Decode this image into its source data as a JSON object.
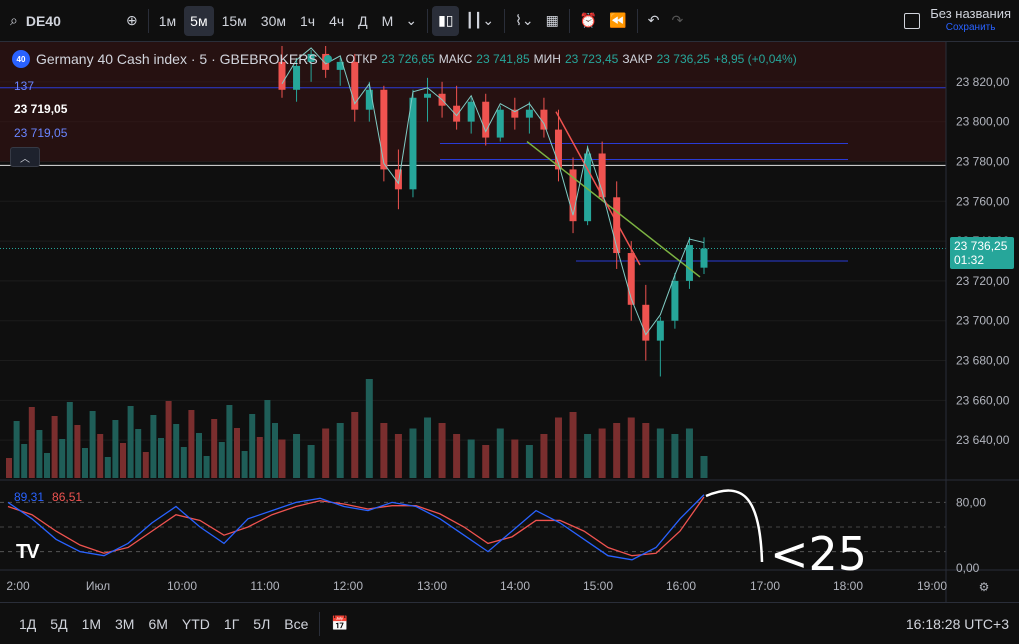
{
  "toolbar": {
    "symbol": "DE40",
    "timeframes": [
      "1м",
      "5м",
      "15м",
      "30м",
      "1ч",
      "4ч",
      "Д",
      "М"
    ],
    "active_timeframe": "5м",
    "title": "Без названия",
    "save_label": "Сохранить"
  },
  "legend": {
    "logo_text": "40",
    "name": "Germany 40 Cash index · 5 · GBEBROKERS",
    "open_label": "ОТКР",
    "open": "23 726,65",
    "high_label": "МАКС",
    "high": "23 741,85",
    "low_label": "МИН",
    "low": "23 723,45",
    "close_label": "ЗАКР",
    "close": "23 736,25",
    "change": "+8,95 (+0,04%)"
  },
  "left_labels": {
    "l1": "137",
    "l2": "23 719,05",
    "l3": "23 719,05"
  },
  "current_price": {
    "price": "23 736,25",
    "countdown": "01:32"
  },
  "price_axis": [
    "23 820,00",
    "23 800,00",
    "23 780,00",
    "23 760,00",
    "23 740,00",
    "23 720,00",
    "23 700,00",
    "23 680,00",
    "23 660,00",
    "23 640,00"
  ],
  "osc_axis": [
    "80,00",
    "0,00"
  ],
  "oscillator": {
    "k": "89,31",
    "d": "86,51"
  },
  "time_axis": [
    "2:00",
    "Июл",
    "10:00",
    "11:00",
    "12:00",
    "13:00",
    "14:00",
    "15:00",
    "16:00",
    "17:00",
    "18:00",
    "19:00"
  ],
  "annotation": "<25",
  "bottom": {
    "ranges": [
      "1Д",
      "5Д",
      "1М",
      "3М",
      "6М",
      "YTD",
      "1Г",
      "5Л",
      "Все"
    ],
    "clock": "16:18:28 UTC+3"
  },
  "colors": {
    "up": "#26a69a",
    "down": "#ef5350",
    "background": "#0f0f0f",
    "grid": "#1c1c1c",
    "accent": "#2962ff",
    "zone": "#3a1414"
  },
  "chart_data": {
    "type": "candlestick",
    "candles": [
      {
        "o": 23830,
        "h": 23838,
        "l": 23812,
        "c": 23816
      },
      {
        "o": 23816,
        "h": 23832,
        "l": 23810,
        "c": 23828
      },
      {
        "o": 23830,
        "h": 23836,
        "l": 23820,
        "c": 23834
      },
      {
        "o": 23834,
        "h": 23838,
        "l": 23822,
        "c": 23826
      },
      {
        "o": 23826,
        "h": 23832,
        "l": 23818,
        "c": 23830
      },
      {
        "o": 23830,
        "h": 23834,
        "l": 23800,
        "c": 23806
      },
      {
        "o": 23806,
        "h": 23820,
        "l": 23800,
        "c": 23816
      },
      {
        "o": 23816,
        "h": 23818,
        "l": 23770,
        "c": 23776
      },
      {
        "o": 23776,
        "h": 23786,
        "l": 23756,
        "c": 23766
      },
      {
        "o": 23766,
        "h": 23816,
        "l": 23762,
        "c": 23812
      },
      {
        "o": 23812,
        "h": 23822,
        "l": 23800,
        "c": 23814
      },
      {
        "o": 23814,
        "h": 23820,
        "l": 23802,
        "c": 23808
      },
      {
        "o": 23808,
        "h": 23818,
        "l": 23796,
        "c": 23800
      },
      {
        "o": 23800,
        "h": 23812,
        "l": 23794,
        "c": 23810
      },
      {
        "o": 23810,
        "h": 23814,
        "l": 23788,
        "c": 23792
      },
      {
        "o": 23792,
        "h": 23808,
        "l": 23790,
        "c": 23806
      },
      {
        "o": 23806,
        "h": 23812,
        "l": 23796,
        "c": 23802
      },
      {
        "o": 23802,
        "h": 23810,
        "l": 23794,
        "c": 23806
      },
      {
        "o": 23806,
        "h": 23812,
        "l": 23792,
        "c": 23796
      },
      {
        "o": 23796,
        "h": 23806,
        "l": 23770,
        "c": 23776
      },
      {
        "o": 23776,
        "h": 23782,
        "l": 23744,
        "c": 23750
      },
      {
        "o": 23750,
        "h": 23788,
        "l": 23748,
        "c": 23784
      },
      {
        "o": 23784,
        "h": 23790,
        "l": 23760,
        "c": 23762
      },
      {
        "o": 23762,
        "h": 23770,
        "l": 23726,
        "c": 23734
      },
      {
        "o": 23734,
        "h": 23740,
        "l": 23700,
        "c": 23708
      },
      {
        "o": 23708,
        "h": 23718,
        "l": 23680,
        "c": 23690
      },
      {
        "o": 23690,
        "h": 23702,
        "l": 23672,
        "c": 23700
      },
      {
        "o": 23700,
        "h": 23724,
        "l": 23696,
        "c": 23720
      },
      {
        "o": 23720,
        "h": 23742,
        "l": 23716,
        "c": 23738
      },
      {
        "o": 23726.65,
        "h": 23741.85,
        "l": 23723.45,
        "c": 23736.25
      }
    ],
    "volume_levels": [
      0.35,
      0.4,
      0.3,
      0.45,
      0.5,
      0.6,
      0.9,
      0.5,
      0.4,
      0.45,
      0.55,
      0.5,
      0.4,
      0.35,
      0.3,
      0.45,
      0.35,
      0.3,
      0.4,
      0.55,
      0.6,
      0.4,
      0.45,
      0.5,
      0.55,
      0.5,
      0.45,
      0.4,
      0.45,
      0.2
    ],
    "stoch_k": [
      80,
      60,
      35,
      20,
      15,
      30,
      55,
      75,
      50,
      30,
      60,
      70,
      80,
      85,
      75,
      70,
      80,
      75,
      60,
      40,
      20,
      45,
      70,
      55,
      35,
      15,
      10,
      25,
      60,
      89.31
    ],
    "stoch_d": [
      75,
      65,
      45,
      28,
      18,
      25,
      45,
      65,
      58,
      40,
      50,
      65,
      75,
      82,
      78,
      72,
      76,
      76,
      66,
      50,
      30,
      38,
      58,
      58,
      45,
      25,
      15,
      18,
      45,
      86.51
    ],
    "ylim": [
      23620,
      23840
    ],
    "osc_ylim": [
      0,
      100
    ]
  }
}
